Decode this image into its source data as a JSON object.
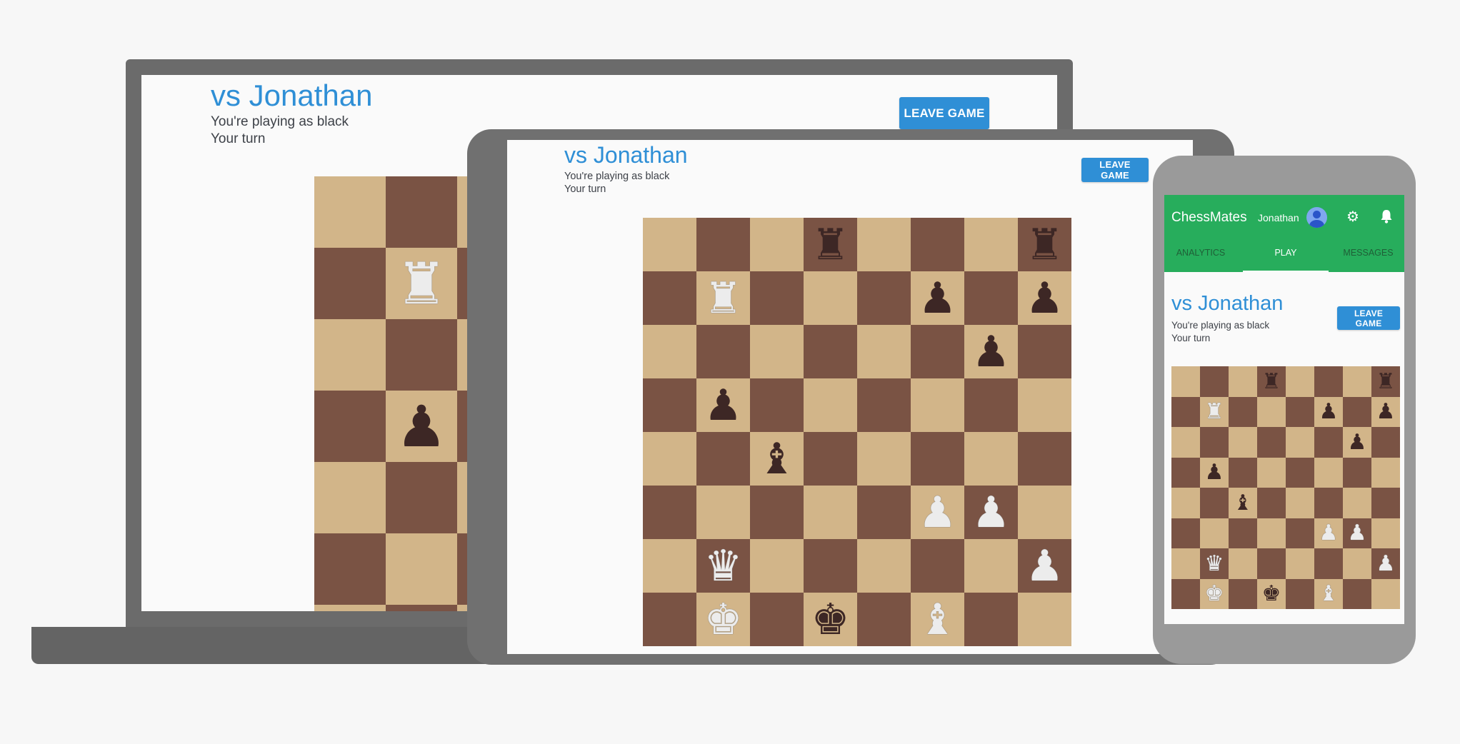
{
  "game": {
    "opponent_title": "vs Jonathan",
    "player_color_text": "You're playing as black",
    "turn_text": "Your turn",
    "leave_label": "LEAVE GAME"
  },
  "phone_app": {
    "brand": "ChessMates",
    "user_name": "Jonathan",
    "tabs": [
      {
        "label": "ANALYTICS",
        "active": false
      },
      {
        "label": "PLAY",
        "active": true
      },
      {
        "label": "MESSAGES",
        "active": false
      }
    ],
    "icons": [
      "avatar-icon",
      "gear-icon",
      "bell-icon"
    ]
  },
  "colors": {
    "accent_blue": "#2f8fd6",
    "app_green": "#27ad5c",
    "light_square": "#d2b589",
    "dark_square": "#7a5344"
  },
  "board": {
    "rows": [
      [
        "",
        "",
        "",
        "bR",
        "",
        "",
        "",
        "bR"
      ],
      [
        "",
        "wR",
        "",
        "",
        "",
        "bP",
        "",
        "bP"
      ],
      [
        "",
        "",
        "",
        "",
        "",
        "",
        "bP",
        ""
      ],
      [
        "",
        "bP",
        "",
        "",
        "",
        "",
        "",
        ""
      ],
      [
        "",
        "",
        "bB",
        "",
        "",
        "",
        "",
        ""
      ],
      [
        "",
        "",
        "",
        "",
        "",
        "wP",
        "wP",
        ""
      ],
      [
        "",
        "wQ",
        "",
        "",
        "",
        "",
        "",
        "wP"
      ],
      [
        "",
        "wK",
        "",
        "bK",
        "",
        "wB",
        "",
        ""
      ]
    ]
  }
}
